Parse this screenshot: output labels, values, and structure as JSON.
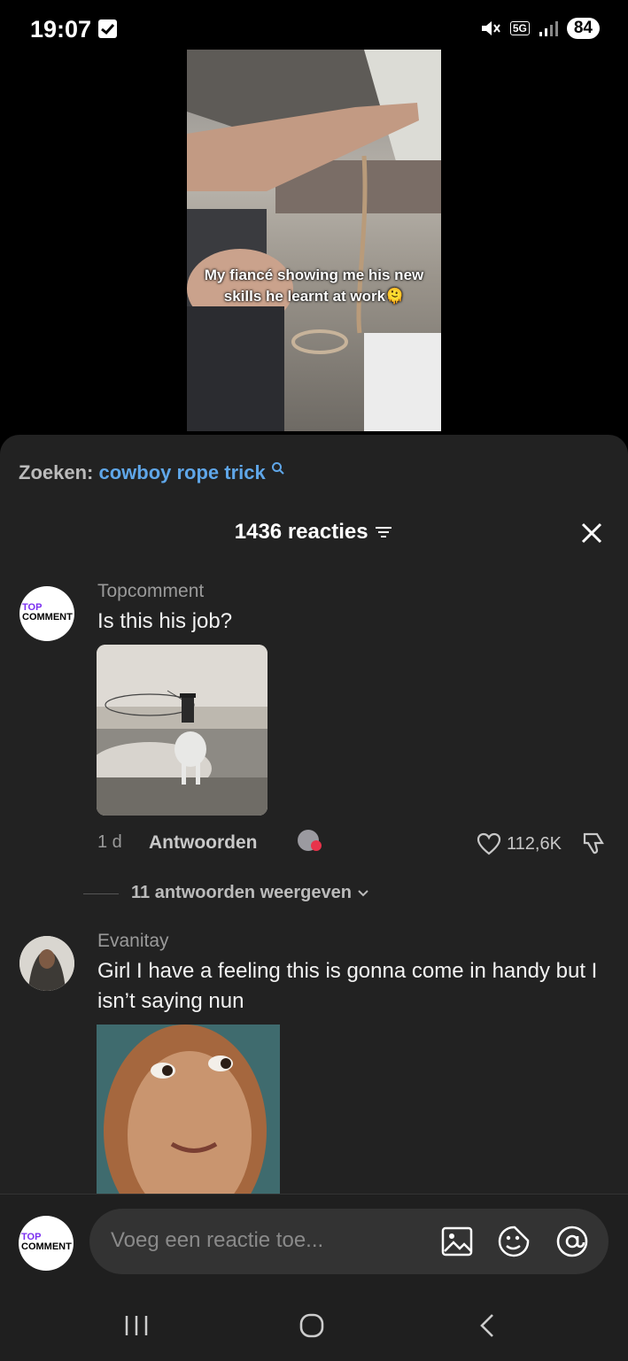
{
  "status_bar": {
    "time": "19:07",
    "network": "5G",
    "battery": "84"
  },
  "video": {
    "caption": "My fiancé showing me his new skills he learnt at work🫠"
  },
  "search": {
    "label": "Zoeken:",
    "query": "cowboy rope trick"
  },
  "comments_header": {
    "count_label": "1436 reacties"
  },
  "comments": [
    {
      "username": "Topcomment",
      "text": "Is this his job?",
      "age": "1 d",
      "reply_label": "Antwoorden",
      "likes": "112,6K",
      "view_replies": "11 antwoorden weergeven"
    },
    {
      "username": "Evanitay",
      "text": "Girl I have a feeling this is gonna come in handy but I isn’t saying nun"
    }
  ],
  "composer": {
    "placeholder": "Voeg een reactie toe..."
  },
  "logo": {
    "line1": "TOP",
    "line2": "COMMENT"
  },
  "colors": {
    "accent_link": "#5fa6e8",
    "panel_bg": "#222222",
    "like_dot": "#e8334a"
  }
}
